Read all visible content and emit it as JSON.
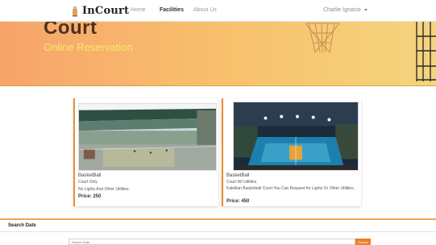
{
  "navbar": {
    "brand": "InCourt",
    "links": [
      {
        "label": "Home"
      },
      {
        "label": "Facilities"
      },
      {
        "label": "About Us"
      }
    ],
    "user_name": "Charlie Ignacio"
  },
  "hero": {
    "title": "Court",
    "subtitle": "Online Reservation"
  },
  "facilities": [
    {
      "title": "BasketBall",
      "subtitle": "Court Only",
      "description": "No Lights And Other Utilities.",
      "price": "Price: 250"
    },
    {
      "title": "BasketBall",
      "subtitle": "Court W/ Utilities",
      "description": "Kalelilan Basketball Court You Can Request for Lights Or Other Utilities.",
      "price": "Price: 450"
    }
  ],
  "search": {
    "label": "Search Date",
    "placeholder": "Search Date",
    "button_label": "Search"
  },
  "colors": {
    "accent": "#ef8c30",
    "hero_start": "#f7a46a",
    "hero_end": "#f4d47e",
    "subtitle": "#f6e86b"
  }
}
